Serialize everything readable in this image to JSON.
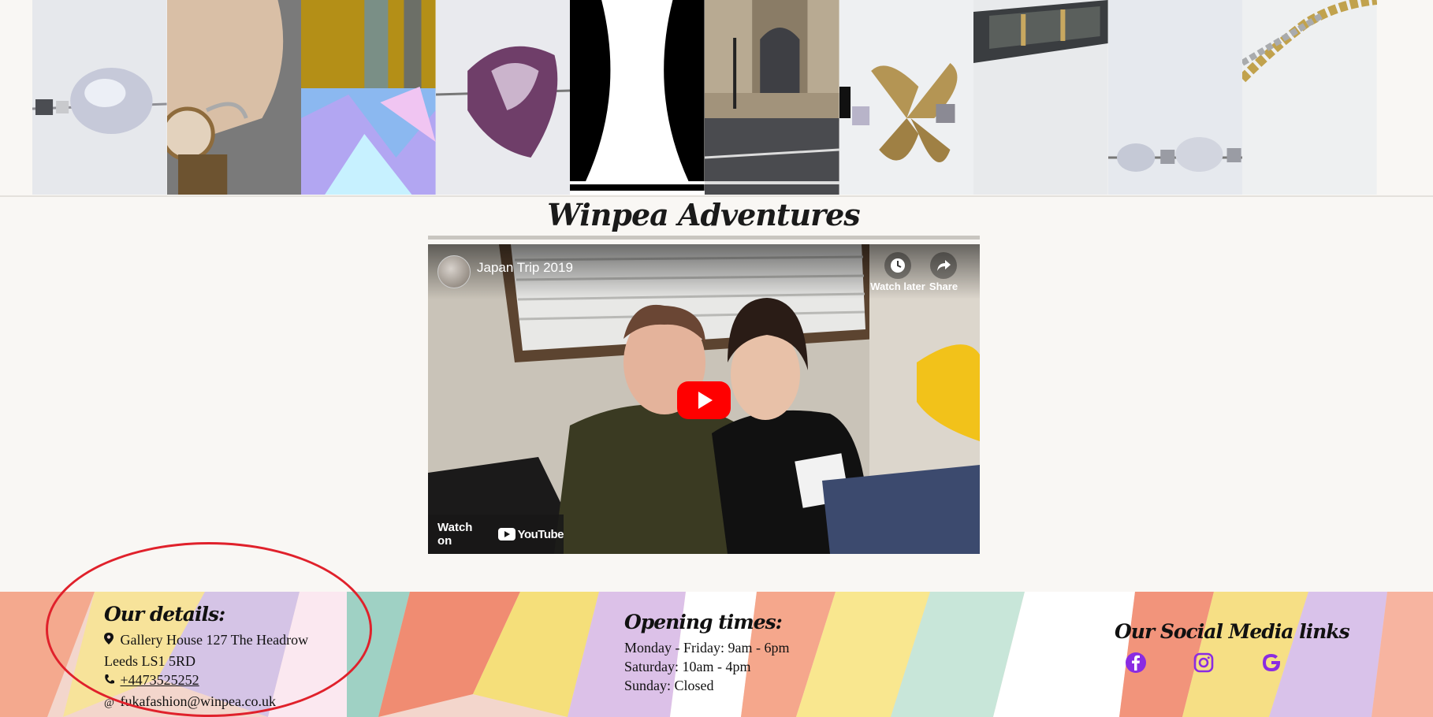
{
  "gallery": {
    "tiles": [
      "pearl-bead-bracelet-tile",
      "wrist-watch-bracelet-tile",
      "holographic-fabric-tile",
      "purple-shell-bead-tile",
      "black-white-silhouette-tile",
      "gallery-building-tile",
      "butterfly-charm-tile",
      "hematite-bracelet-tile",
      "pearl-chain-tile",
      "gold-chain-tile"
    ]
  },
  "section": {
    "title": "Winpea Adventures"
  },
  "video": {
    "title": "Japan Trip 2019",
    "watch_later": "Watch later",
    "share": "Share",
    "watch_on": "Watch on",
    "youtube": "YouTube",
    "play_color": "#ff0000"
  },
  "footer": {
    "details": {
      "heading": "Our details:",
      "address_line1": "Gallery House 127 The Headrow",
      "address_line2": "Leeds LS1 5RD",
      "phone": "+4473525252",
      "email": "fukafashion@winpea.co.uk"
    },
    "opening": {
      "heading": "Opening times:",
      "weekdays": "Monday - Friday: 9am - 6pm",
      "saturday": "Saturday: 10am - 4pm",
      "sunday": "Sunday: Closed"
    },
    "social": {
      "heading": "Our Social Media links",
      "icons": [
        "facebook-icon",
        "instagram-icon",
        "google-icon"
      ],
      "icon_color": "#8a2be2"
    }
  },
  "annotation_color": "#e0212b"
}
